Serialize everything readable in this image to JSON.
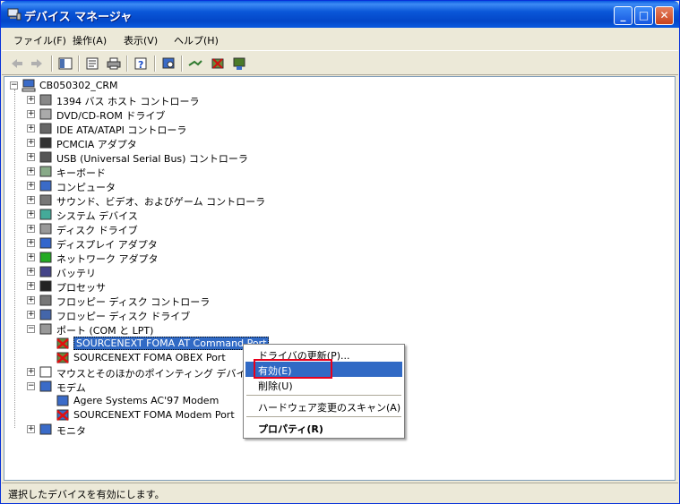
{
  "window": {
    "title": "デバイス マネージャ"
  },
  "menu": [
    "ファイル(F)",
    "操作(A)",
    "表示(V)",
    "ヘルプ(H)"
  ],
  "toolbar_icons": [
    "back-arrow-icon",
    "forward-arrow-icon",
    "show-hide-tree-icon",
    "properties-icon",
    "print-icon",
    "help-icon",
    "scan-hardware-icon",
    "update-driver-icon",
    "uninstall-icon",
    "disable-icon"
  ],
  "tree": {
    "root": "CB050302_CRM",
    "categories": [
      "1394 バス ホスト コントローラ",
      "DVD/CD-ROM ドライブ",
      "IDE ATA/ATAPI コントローラ",
      "PCMCIA アダプタ",
      "USB (Universal Serial Bus) コントローラ",
      "キーボード",
      "コンピュータ",
      "サウンド、ビデオ、およびゲーム コントローラ",
      "システム デバイス",
      "ディスク ドライブ",
      "ディスプレイ アダプタ",
      "ネットワーク アダプタ",
      "バッテリ",
      "プロセッサ",
      "フロッピー ディスク コントローラ",
      "フロッピー ディスク ドライブ",
      "ポート (COM と LPT)"
    ],
    "ports_children": [
      "SOURCENEXT FOMA AT Command Port",
      "SOURCENEXT FOMA OBEX Port"
    ],
    "mouse": "マウスとそのほかのポインティング デバイス",
    "modem": "モデム",
    "modem_children": [
      "Agere Systems AC'97 Modem",
      "SOURCENEXT FOMA Modem Port"
    ],
    "monitor": "モニタ"
  },
  "context_menu": {
    "update_driver": "ドライバの更新(P)...",
    "enable": "有効(E)",
    "delete": "削除(U)",
    "scan": "ハードウェア変更のスキャン(A)",
    "properties": "プロパティ(R)"
  },
  "status": "選択したデバイスを有効にします。",
  "colors": {
    "selection": "#316ac5",
    "highlight_box": "#e8001c",
    "titlebar": "#0a57d8"
  }
}
